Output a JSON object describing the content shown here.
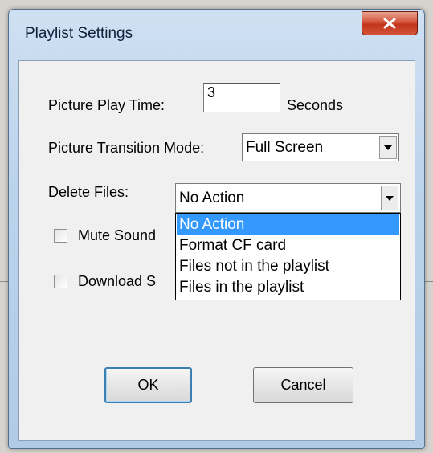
{
  "window": {
    "title": "Playlist Settings"
  },
  "form": {
    "play_time_label": "Picture Play Time:",
    "play_time_value": "3",
    "play_time_unit": "Seconds",
    "transition_label": "Picture Transition Mode:",
    "transition_value": "Full Screen",
    "delete_label": "Delete Files:",
    "delete_value": "No Action",
    "mute_label": "Mute Sound",
    "download_label": "Download S"
  },
  "dropdown": {
    "options": [
      "No Action",
      "Format CF card",
      "Files not in the playlist",
      "Files in the playlist"
    ],
    "selected_index": 0
  },
  "buttons": {
    "ok": "OK",
    "cancel": "Cancel"
  },
  "colors": {
    "selection": "#3399ff",
    "close_button": "#c9432a"
  }
}
